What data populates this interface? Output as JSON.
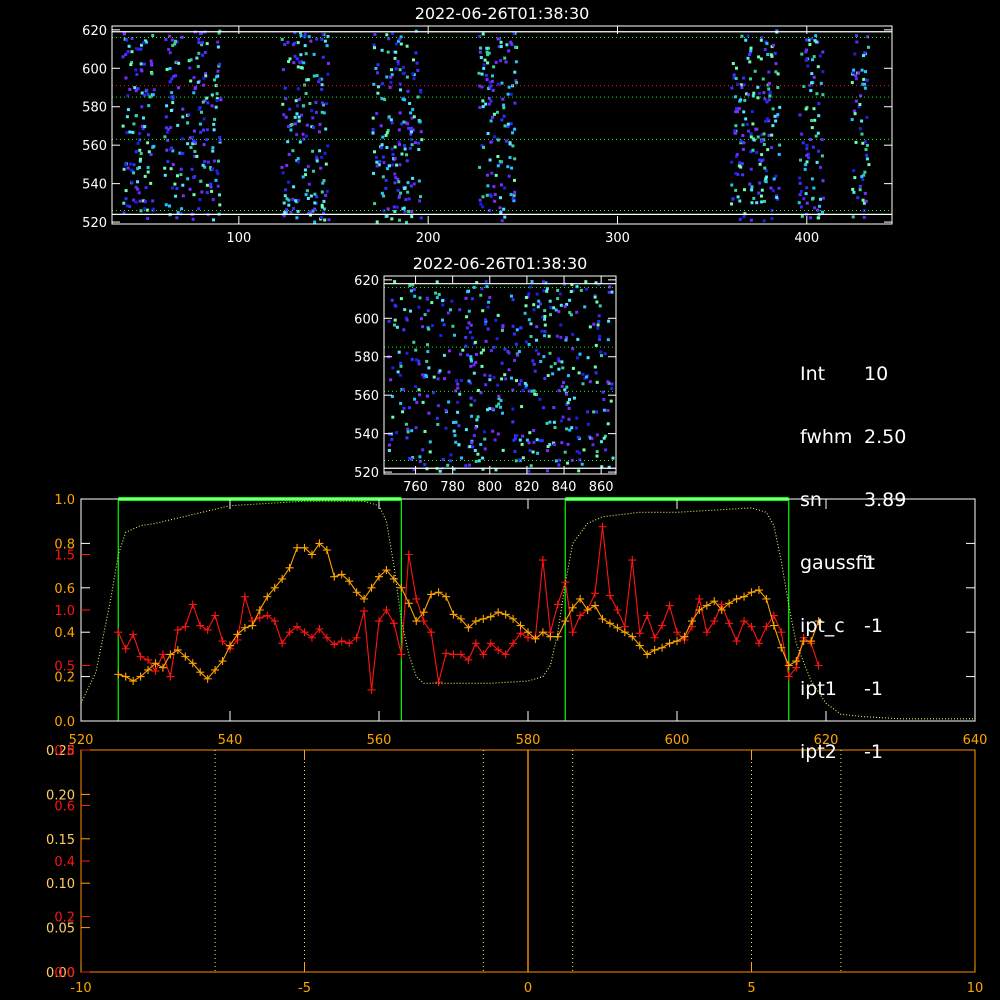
{
  "colors": {
    "white": "#ffffff",
    "green": "#00ff00",
    "red": "#ff1414",
    "orange": "#ffa500",
    "yellow_dotted": "#c8ff64",
    "spot_palette": [
      "#2020e0",
      "#3030ff",
      "#5a2dff",
      "#7a2fff",
      "#22c4ff",
      "#4fe8ff",
      "#3ad09a",
      "#70ffb0"
    ]
  },
  "info_panel": {
    "rows": [
      {
        "key": "Int",
        "value": "10"
      },
      {
        "key": "fwhm",
        "value": "2.50"
      },
      {
        "key": "sn",
        "value": "3.89"
      },
      {
        "key": "gaussfit",
        "value": "1"
      },
      {
        "key": "ipt_c",
        "value": "-1"
      },
      {
        "key": "ipt1",
        "value": "-1"
      },
      {
        "key": "ipt2",
        "value": "-1"
      }
    ]
  },
  "chart_data": [
    {
      "type": "heatmap",
      "title": "2022-06-26T01:38:30",
      "xlim": [
        33,
        445
      ],
      "ylim": [
        519,
        622
      ],
      "xticks": [
        100,
        200,
        300,
        400
      ],
      "yticks": [
        520,
        540,
        560,
        580,
        600,
        620
      ],
      "column_bands": [
        [
          38,
          55
        ],
        [
          60,
          70
        ],
        [
          72,
          90
        ],
        [
          122,
          147
        ],
        [
          170,
          196
        ],
        [
          226,
          246
        ],
        [
          359,
          385
        ],
        [
          395,
          408
        ],
        [
          423,
          432
        ]
      ],
      "white_hlines": [
        619,
        524
      ],
      "green_dotted_hlines": [
        616,
        585,
        563,
        526
      ],
      "red_dotted_hlines": [
        591
      ]
    },
    {
      "type": "heatmap",
      "title": "2022-06-26T01:38:30",
      "xlim": [
        743,
        868
      ],
      "ylim": [
        519,
        622
      ],
      "xticks": [
        760,
        780,
        800,
        820,
        840,
        860
      ],
      "yticks": [
        520,
        540,
        560,
        580,
        600,
        620
      ],
      "white_hlines": [
        618,
        522
      ],
      "green_dotted_hlines": [
        616,
        585,
        562,
        526
      ],
      "red_dotted_hlines": []
    },
    {
      "type": "line",
      "title": "",
      "xlim": [
        520,
        640
      ],
      "xticks": [
        520,
        540,
        560,
        580,
        600,
        620,
        640
      ],
      "left_axis_white": {
        "ylim": [
          0.0,
          1.0
        ],
        "ticks": [
          "0.0",
          "0.2",
          "0.4",
          "0.6",
          "0.8",
          "1.0"
        ]
      },
      "left_axis_red": {
        "ylim": [
          0.0,
          2.0
        ],
        "ticks": [
          "0.5",
          "1.0",
          "1.5"
        ]
      },
      "green_windows": [
        [
          525,
          563
        ],
        [
          585,
          615
        ]
      ],
      "series": [
        {
          "color": "red",
          "marker": "+",
          "axis": "red",
          "x": [
            525,
            526,
            527,
            528,
            529,
            530,
            531,
            532,
            533,
            534,
            535,
            536,
            537,
            538,
            539,
            540,
            541,
            542,
            543,
            544,
            545,
            546,
            547,
            548,
            549,
            550,
            551,
            552,
            553,
            554,
            555,
            556,
            557,
            558,
            559,
            560,
            561,
            562,
            563,
            564,
            565,
            566,
            567,
            568,
            569,
            570,
            571,
            572,
            573,
            574,
            575,
            576,
            577,
            578,
            579,
            580,
            581,
            582,
            583,
            584,
            585,
            586,
            587,
            588,
            589,
            590,
            591,
            592,
            593,
            594,
            595,
            596,
            597,
            598,
            599,
            600,
            601,
            602,
            603,
            604,
            605,
            606,
            607,
            608,
            609,
            610,
            611,
            612,
            613,
            614,
            615,
            616,
            617,
            618,
            619
          ],
          "values": [
            0.8,
            0.65,
            0.78,
            0.58,
            0.55,
            0.45,
            0.6,
            0.4,
            0.82,
            0.85,
            1.05,
            0.86,
            0.82,
            0.95,
            0.72,
            0.65,
            0.73,
            1.12,
            0.9,
            0.93,
            0.95,
            0.9,
            0.7,
            0.8,
            0.85,
            0.8,
            0.75,
            0.83,
            0.75,
            0.69,
            0.72,
            0.7,
            0.75,
            0.99,
            0.28,
            0.9,
            1.0,
            0.88,
            0.6,
            1.5,
            1.1,
            0.9,
            0.8,
            0.35,
            0.61,
            0.6,
            0.6,
            0.55,
            0.7,
            0.6,
            0.7,
            0.64,
            0.6,
            0.7,
            0.79,
            0.75,
            0.76,
            1.45,
            0.8,
            1.05,
            1.25,
            0.8,
            0.95,
            1.0,
            1.15,
            1.75,
            1.13,
            1.0,
            0.85,
            1.45,
            0.79,
            0.95,
            0.75,
            0.86,
            1.04,
            0.8,
            0.73,
            0.85,
            1.1,
            0.8,
            0.9,
            1.05,
            0.88,
            0.72,
            0.9,
            0.85,
            0.7,
            0.85,
            0.95,
            0.8,
            0.4,
            0.48,
            0.75,
            0.7,
            0.5
          ]
        },
        {
          "color": "orange",
          "marker": "+",
          "axis": "white",
          "x": [
            525,
            526,
            527,
            528,
            529,
            530,
            531,
            532,
            533,
            534,
            535,
            536,
            537,
            538,
            539,
            540,
            541,
            542,
            543,
            544,
            545,
            546,
            547,
            548,
            549,
            550,
            551,
            552,
            553,
            554,
            555,
            556,
            557,
            558,
            559,
            560,
            561,
            562,
            563,
            564,
            565,
            566,
            567,
            568,
            569,
            570,
            571,
            572,
            573,
            574,
            575,
            576,
            577,
            578,
            579,
            580,
            581,
            582,
            583,
            584,
            585,
            586,
            587,
            588,
            589,
            590,
            591,
            592,
            593,
            594,
            595,
            596,
            597,
            598,
            599,
            600,
            601,
            602,
            603,
            604,
            605,
            606,
            607,
            608,
            609,
            610,
            611,
            612,
            613,
            614,
            615,
            616,
            617,
            618,
            619
          ],
          "values": [
            0.21,
            0.2,
            0.18,
            0.2,
            0.23,
            0.26,
            0.24,
            0.3,
            0.32,
            0.29,
            0.26,
            0.22,
            0.19,
            0.23,
            0.27,
            0.34,
            0.39,
            0.42,
            0.43,
            0.5,
            0.56,
            0.6,
            0.64,
            0.69,
            0.78,
            0.78,
            0.75,
            0.8,
            0.77,
            0.65,
            0.66,
            0.63,
            0.58,
            0.55,
            0.6,
            0.65,
            0.68,
            0.64,
            0.6,
            0.53,
            0.45,
            0.49,
            0.57,
            0.58,
            0.56,
            0.48,
            0.46,
            0.42,
            0.45,
            0.46,
            0.47,
            0.49,
            0.48,
            0.46,
            0.43,
            0.4,
            0.37,
            0.4,
            0.38,
            0.38,
            0.45,
            0.51,
            0.55,
            0.5,
            0.52,
            0.46,
            0.44,
            0.42,
            0.4,
            0.38,
            0.34,
            0.3,
            0.32,
            0.33,
            0.35,
            0.36,
            0.38,
            0.45,
            0.5,
            0.52,
            0.54,
            0.5,
            0.53,
            0.55,
            0.56,
            0.58,
            0.59,
            0.55,
            0.43,
            0.33,
            0.25,
            0.27,
            0.36,
            0.36,
            0.45
          ]
        },
        {
          "color": "yellow_dotted",
          "marker": "none",
          "axis": "white",
          "x": [
            520,
            522,
            524,
            525,
            526,
            528,
            530,
            535,
            540,
            545,
            550,
            555,
            558,
            560,
            561,
            562,
            563,
            564,
            565,
            566,
            568,
            570,
            575,
            580,
            582,
            583,
            584,
            585,
            586,
            588,
            590,
            595,
            600,
            605,
            610,
            612,
            613,
            614,
            615,
            616,
            618,
            620,
            622,
            625,
            630,
            635,
            640
          ],
          "values": [
            0.08,
            0.22,
            0.55,
            0.75,
            0.85,
            0.88,
            0.89,
            0.93,
            0.97,
            0.98,
            0.99,
            0.99,
            0.99,
            0.97,
            0.9,
            0.7,
            0.45,
            0.3,
            0.2,
            0.17,
            0.17,
            0.17,
            0.17,
            0.18,
            0.2,
            0.25,
            0.4,
            0.62,
            0.8,
            0.89,
            0.92,
            0.94,
            0.94,
            0.95,
            0.96,
            0.94,
            0.88,
            0.72,
            0.52,
            0.35,
            0.18,
            0.08,
            0.03,
            0.02,
            0.01,
            0.01,
            0.01
          ]
        }
      ]
    },
    {
      "type": "line",
      "title": "",
      "xlim": [
        -10,
        10
      ],
      "xticks": [
        -10,
        -5,
        0,
        5,
        10
      ],
      "left_axis_yellow": {
        "ylim": [
          0.0,
          0.25
        ],
        "ticks": [
          "0.00",
          "0.05",
          "0.10",
          "0.15",
          "0.20",
          "0.25"
        ]
      },
      "left_axis_red": {
        "ylim": [
          0.0,
          0.8
        ],
        "ticks": [
          "0.0",
          "0.2",
          "0.4",
          "0.6",
          "0.8"
        ]
      },
      "dotted_vlines": [
        -7,
        -5,
        -1,
        1,
        5,
        7
      ],
      "orange_vline": [
        0
      ]
    }
  ]
}
